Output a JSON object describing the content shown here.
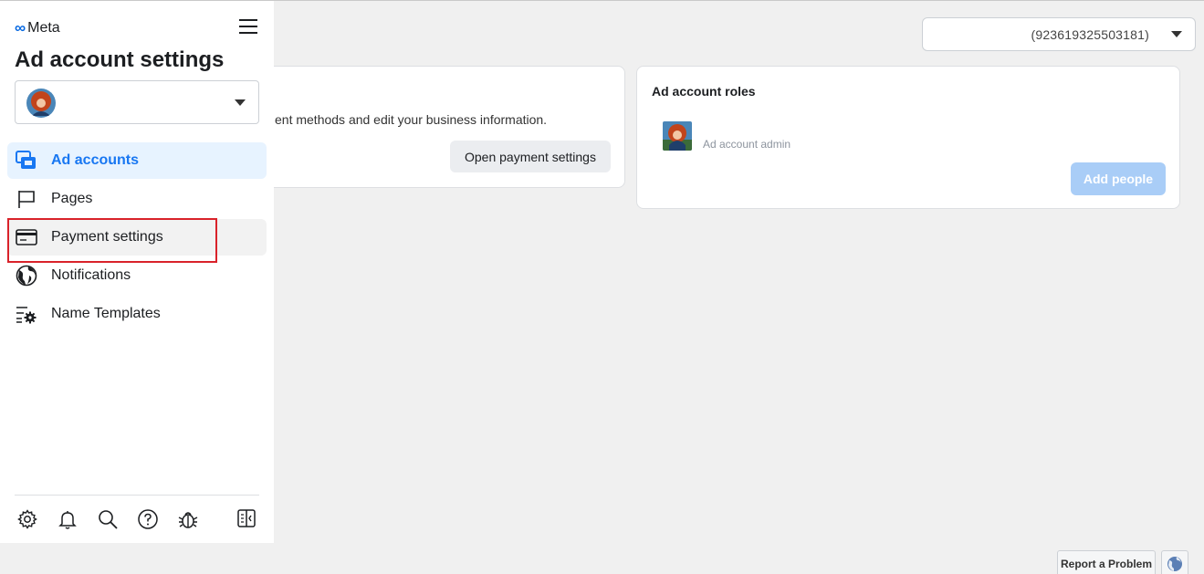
{
  "brand": {
    "logo_text": "Meta"
  },
  "sidebar": {
    "title": "Ad account settings",
    "nav": [
      {
        "label": "Ad accounts",
        "icon": "ad-accounts-icon",
        "state": "active"
      },
      {
        "label": "Pages",
        "icon": "flag-icon",
        "state": "normal"
      },
      {
        "label": "Payment settings",
        "icon": "credit-card-icon",
        "state": "hover"
      },
      {
        "label": "Notifications",
        "icon": "globe-icon",
        "state": "normal"
      },
      {
        "label": "Name Templates",
        "icon": "list-gear-icon",
        "state": "normal"
      }
    ],
    "bottom_icons": [
      "gear-icon",
      "bell-icon",
      "search-icon",
      "help-icon",
      "bug-icon",
      "panel-toggle-icon"
    ]
  },
  "account_selector": {
    "account_id": "(923619325503181)"
  },
  "payment_card": {
    "description": "ent methods and edit your business information.",
    "button_label": "Open payment settings"
  },
  "roles_card": {
    "title": "Ad account roles",
    "role_label": "Ad account admin",
    "add_button_label": "Add people"
  },
  "footer": {
    "report_label": "Report a Problem"
  },
  "colors": {
    "accent": "#1877f2",
    "highlight": "#d9222a",
    "active_bg": "#e7f3ff",
    "disabled_blue": "#a9cdf7"
  }
}
